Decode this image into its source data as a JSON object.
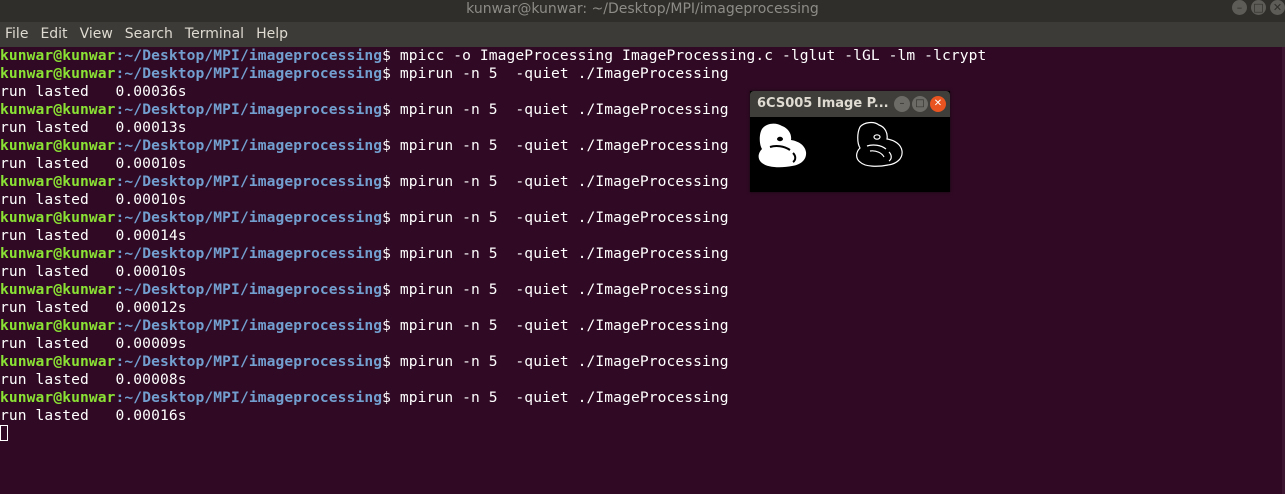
{
  "window": {
    "title": "kunwar@kunwar: ~/Desktop/MPI/imageprocessing",
    "buttons": {
      "minimize": "–",
      "maximize": "□",
      "close": "✕"
    }
  },
  "menu": [
    "File",
    "Edit",
    "View",
    "Search",
    "Terminal",
    "Help"
  ],
  "terminal": {
    "prompt_user": "kunwar@kunwar",
    "prompt_path": ":~/Desktop/MPI/imageprocessing",
    "prompt_symbol": "$",
    "lines": [
      {
        "type": "cmd",
        "text": " mpicc -o ImageProcessing ImageProcessing.c -lglut -lGL -lm -lcrypt"
      },
      {
        "type": "cmd",
        "text": " mpirun -n 5  -quiet ./ImageProcessing"
      },
      {
        "type": "out",
        "text": "run lasted   0.00036s"
      },
      {
        "type": "cmd",
        "text": " mpirun -n 5  -quiet ./ImageProcessing"
      },
      {
        "type": "out",
        "text": "run lasted   0.00013s"
      },
      {
        "type": "cmd",
        "text": " mpirun -n 5  -quiet ./ImageProcessing"
      },
      {
        "type": "out",
        "text": "run lasted   0.00010s"
      },
      {
        "type": "cmd",
        "text": " mpirun -n 5  -quiet ./ImageProcessing"
      },
      {
        "type": "out",
        "text": "run lasted   0.00010s"
      },
      {
        "type": "cmd",
        "text": " mpirun -n 5  -quiet ./ImageProcessing"
      },
      {
        "type": "out",
        "text": "run lasted   0.00014s"
      },
      {
        "type": "cmd",
        "text": " mpirun -n 5  -quiet ./ImageProcessing"
      },
      {
        "type": "out",
        "text": "run lasted   0.00010s"
      },
      {
        "type": "cmd",
        "text": " mpirun -n 5  -quiet ./ImageProcessing"
      },
      {
        "type": "out",
        "text": "run lasted   0.00012s"
      },
      {
        "type": "cmd",
        "text": " mpirun -n 5  -quiet ./ImageProcessing"
      },
      {
        "type": "out",
        "text": "run lasted   0.00009s"
      },
      {
        "type": "cmd",
        "text": " mpirun -n 5  -quiet ./ImageProcessing"
      },
      {
        "type": "out",
        "text": "run lasted   0.00008s"
      },
      {
        "type": "cmd",
        "text": " mpirun -n 5  -quiet ./ImageProcessing"
      },
      {
        "type": "out",
        "text": "run lasted   0.00016s"
      }
    ]
  },
  "image_window": {
    "title": "6CS005 Image P...",
    "buttons": {
      "minimize": "–",
      "maximize": "□",
      "close": "✕"
    }
  },
  "colors": {
    "background": "#300a24",
    "prompt_user": "#8ae234",
    "prompt_path": "#729fcf",
    "close_button": "#e95420"
  }
}
